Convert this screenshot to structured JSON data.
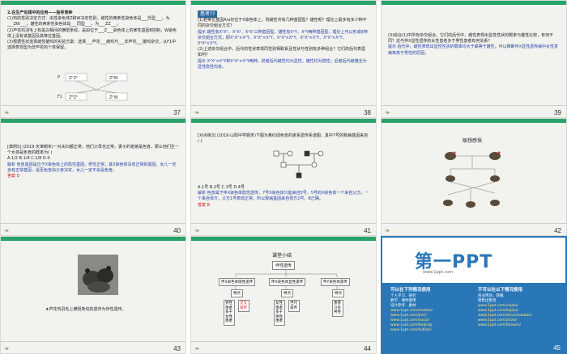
{
  "slides": [
    {
      "number": "37",
      "title": "2.在生产实践中的应用——指导育种",
      "lines": [
        "(1)鸡的性别决定方式：由性染色体Z和W决定性别，雌性的两条性染色体是___异型___，为___ZW___；雄性的两条性染色体是___同型___，为___ZZ___。",
        "(2)芦花鸡羽毛上有黑白相间的横斑条纹，是由位于___Z___染色体上的某性基因B控制，W染色体上没有该基因及其等位基因。",
        "(3)根据性状选择雌性雄鸡的实验方案：选择___芦花___雌鸡与___非芦花___雄鸡杂交，从F1中选择表现型为非芦花的个体保留。"
      ],
      "answers": [
        "异型",
        "ZW",
        "同型",
        "ZZ",
        "Z",
        "芦花",
        "非芦花"
      ],
      "cross_labels": [
        "P",
        "ZᵇZᵇ",
        "ZᴮW",
        "F1",
        "ZᴮZᵇ",
        "ZᵇW"
      ]
    },
    {
      "number": "38",
      "think_label": "思考??",
      "lines": [
        "(1)若等位基因A/a仅位于X染色体上，则雌性共有几种基因型？雄性呢？理论上最多有多少种不同的杂交组合方式？",
        "提示 雌性有XᴬXᴬ、XᴬXᵃ、XᵃXᵃ三种基因型，雄性有XᴬY、XᵃY两种基因型；理论上可以形成6种杂交组合方式，即XᴬXᴬ×XᴬY、XᴬXᴬ×XᵃY、XᴬXᵃ×XᴬY、XᴬXᵃ×XᵃY、XᵃXᵃ×XᴬY、XᵃXᵃ×XᵃY。",
        "(2)上述杂交组合中，后代的性状表现同性别相联系且性状与性别有多种组合？它们的后代表型如何？",
        "提示 XᵃXᵃ×XᴬY和XᴬXᵃ×XᵃY两种。前者后代雌性均为显性，雄性均为隐性；后者后代雌雄全为显性隐性均有。"
      ]
    },
    {
      "number": "39",
      "lines": [
        "(3)综合(1)中所有杂交组合，它们的后代中，雌性表现出显性性状的概率与雄性比较，有何不同？这与伴X显性遗传的女性患者多于男性患者有何关系？",
        "提示 后代中，雌性表现出显性性状的概率均大于或等于雄性，可以推断伴X显性遗传病中女性发病率高于男性的原因。"
      ]
    },
    {
      "number": "40",
      "lines": [
        "[典例5] (2019·天津期末)一对夫妇都正常，他们父母也正常，妻子的弟弟是色盲，那么他们生一个女孩是色盲的概率为( )",
        "A.1/2    B.1/4    C.1/8    D.0",
        "解析 色盲基因是位于X染色体上的隐性基因，男性正常，其X染色体没有正常的基因。女儿一定含有正常基因，是否色盲由父亲决定，女儿一定不会是色盲。",
        "答案 D"
      ]
    },
    {
      "number": "41",
      "lines": [
        "[对点练3] (2019·山阳中学期末)下图为某红绿色盲的家系遗传系谱图，其中7号的致病基因来自( )",
        "A.1号    B.2号    C.3号    D.4号",
        "解析 色盲属于伴X染色体隐性遗传，7号X染色体只能来自5号，5号的X染色体一个来自父方，一个来自母方，父方1号表现正常，所以致病基因来自母方2号，B正确。",
        "答案 B"
      ]
    },
    {
      "number": "42",
      "title": "联想感悟",
      "lines": []
    },
    {
      "number": "43",
      "caption": "★芦花鸡羽毛上横斑条纹的遗传为伴性遗传。"
    },
    {
      "number": "44",
      "title": "课堂小结",
      "root": "伴性遗传",
      "branches": [
        "伴X染色体隐性遗传",
        "伴X染色体显性遗传",
        "伴Y染色体遗传"
      ],
      "traits": [
        "特点",
        "特点",
        "特点"
      ],
      "leaves": [
        "男性患者多于女性患者",
        "交叉遗传",
        "女性患者多于男性患者",
        "世代遗传",
        "患者只有男性"
      ]
    },
    {
      "number": "45",
      "logo": "第一PPT",
      "sub": "www.1ppt.com",
      "col1_title": "可以在下列情况使用",
      "col1": [
        "个人学习、研究",
        "教学、课件使用",
        "设计参考、素材",
        "www.1ppt.com/moban/",
        "www.1ppt.com/jieri/",
        "www.1ppt.com/sucai/",
        "www.1ppt.com/beijing/",
        "www.1ppt.com/tubiao/"
      ],
      "col2_title": "不可以在以下情况使用",
      "col2": [
        "商业用途、转载",
        "转售出售等",
        "www.1ppt.com/xiazai/",
        "www.1ppt.com/kejian/",
        "www.1ppt.com/shouchaobao/",
        "www.1ppt.com/ziliao/",
        "www.1ppt.com/fanwen/"
      ]
    }
  ],
  "accent": "#29a36a",
  "link_blue": "#1f3fa8",
  "answer_red": "#d02020"
}
